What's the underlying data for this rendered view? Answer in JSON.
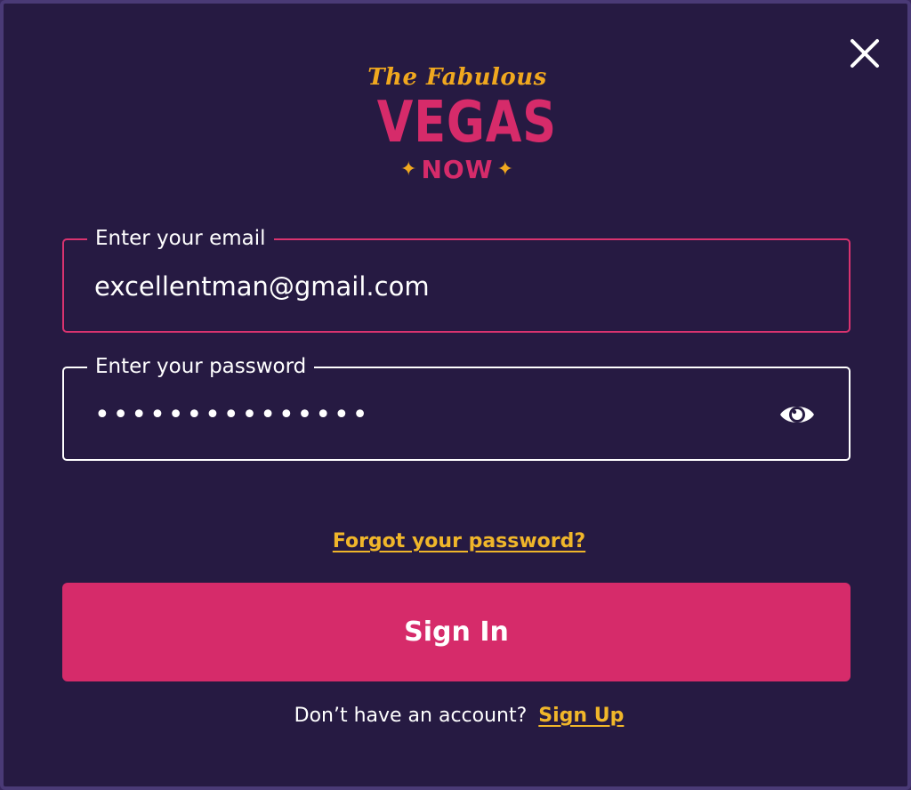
{
  "logo": {
    "script_text": "The Fabulous",
    "main_text": "VEGAS",
    "sub_text": "NOW",
    "star_glyph": "✦"
  },
  "email_field": {
    "label": "Enter your email",
    "value": "excellentman@gmail.com"
  },
  "password_field": {
    "label": "Enter your password",
    "value": "•••••••••••••••",
    "toggle_icon": "eye-icon"
  },
  "forgot_password": {
    "text": "Forgot your password?"
  },
  "sign_in_button": {
    "label": "Sign In"
  },
  "signup": {
    "prompt": "Don’t have an account?",
    "link_text": "Sign Up"
  },
  "colors": {
    "background": "#261a42",
    "accent_pink": "#d62b6a",
    "accent_gold": "#f0b62a",
    "text": "#ffffff"
  }
}
